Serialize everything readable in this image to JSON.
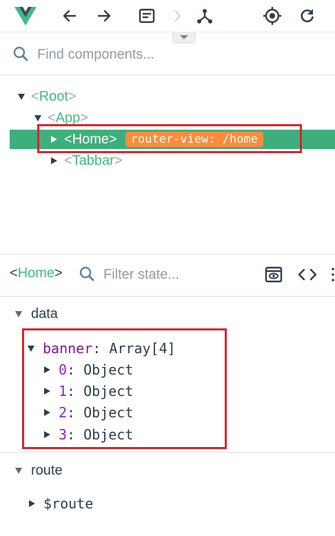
{
  "toolbar": {
    "logo": "vue-logo",
    "buttons": [
      "back-arrow-icon",
      "forward-arrow-icon",
      "components-tab-icon",
      "chevron-right-icon",
      "vuex-icon",
      "inspect-target-icon",
      "refresh-icon"
    ]
  },
  "search": {
    "placeholder": "Find components..."
  },
  "tree": {
    "root": "Root",
    "app": "App",
    "home": "Home",
    "home_badge": "router-view: /home",
    "tabbar": "Tabbar"
  },
  "inspector": {
    "component": "Home",
    "filter_placeholder": "Filter state..."
  },
  "state": {
    "data_label": "data",
    "banner_key": "banner",
    "banner_value": "Array[4]",
    "items": [
      {
        "key": "0",
        "value": "Object"
      },
      {
        "key": "1",
        "value": "Object"
      },
      {
        "key": "2",
        "value": "Object"
      },
      {
        "key": "3",
        "value": "Object"
      }
    ],
    "route_label": "route",
    "route_key": "$route"
  },
  "colors": {
    "accent": "#42b983",
    "selected": "#3eaf7c",
    "badge": "#fb8c3c",
    "highlight": "#e0202a"
  }
}
